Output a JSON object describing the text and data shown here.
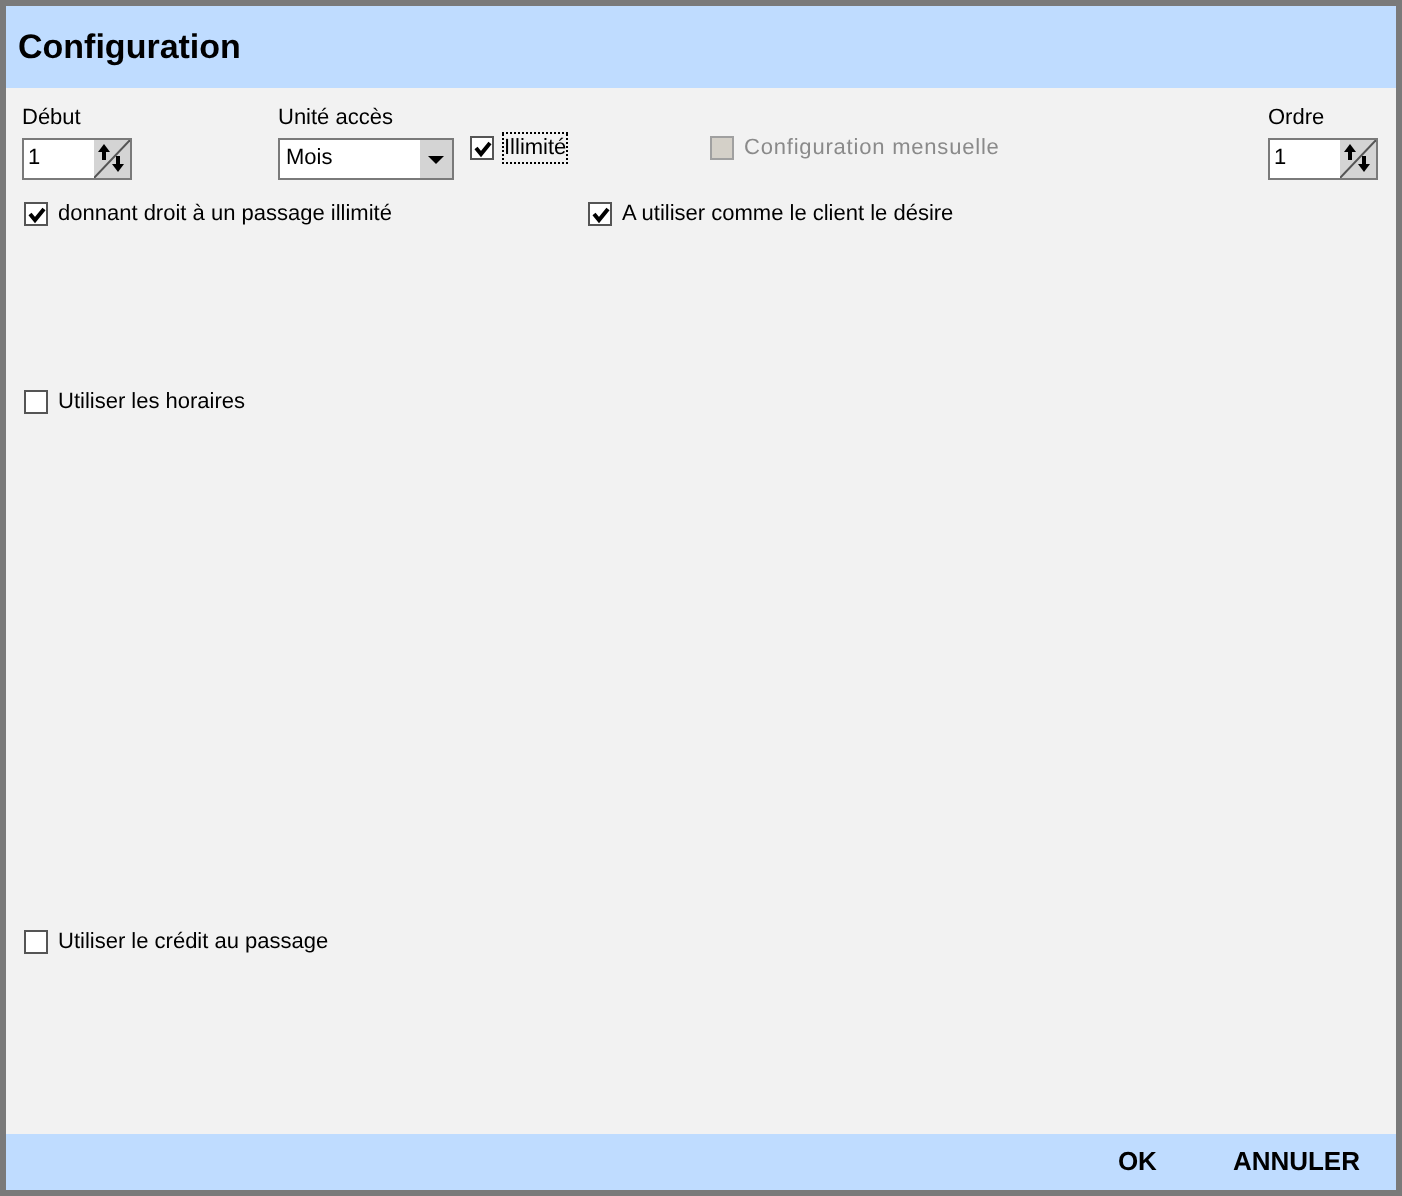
{
  "window": {
    "title": "Configuration"
  },
  "debut": {
    "label": "Début",
    "value": "1"
  },
  "unite_acces": {
    "label": "Unité accès",
    "value": "Mois"
  },
  "illimite": {
    "label": "Illimité",
    "checked": true,
    "focused": true
  },
  "configuration_mensuelle": {
    "label": "Configuration mensuelle",
    "checked": false,
    "disabled": true
  },
  "ordre": {
    "label": "Ordre",
    "value": "1"
  },
  "options_row": [
    {
      "label": "donnant droit à un passage illimité",
      "checked": true
    },
    {
      "label": "A utiliser comme le client le désire",
      "checked": true
    }
  ],
  "utiliser_horaires": {
    "label": "Utiliser les horaires",
    "checked": false
  },
  "utiliser_credit": {
    "label": "Utiliser le crédit au passage",
    "checked": false
  },
  "buttons": [
    {
      "label": "OK"
    },
    {
      "label": "ANNULER"
    }
  ]
}
